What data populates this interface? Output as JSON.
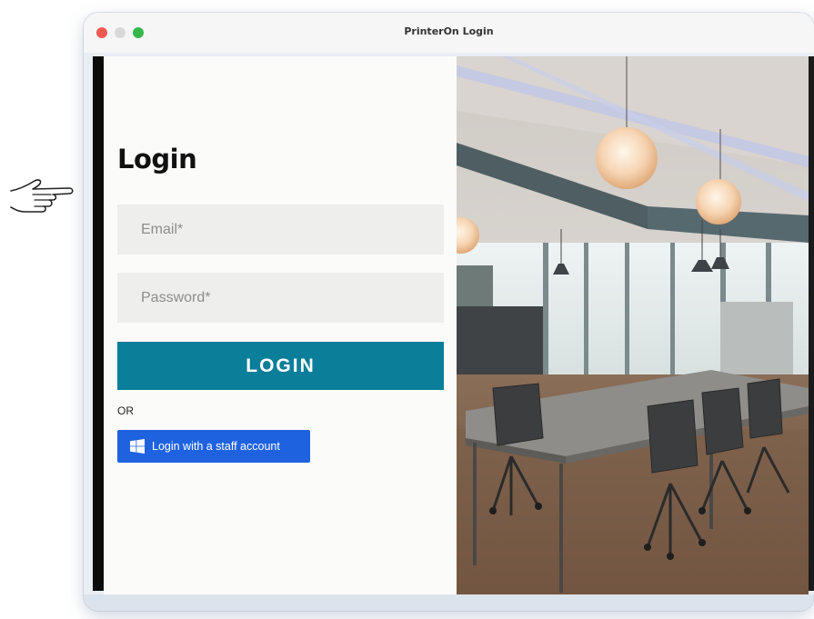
{
  "window": {
    "title": "PrinterOn Login"
  },
  "login": {
    "heading": "Login",
    "email_placeholder": "Email*",
    "password_placeholder": "Password*",
    "submit_label": "LOGIN",
    "or_text": "OR",
    "staff_button_label": "Login with a staff account"
  },
  "icons": {
    "pointer": "pointing-hand-icon",
    "staff_button": "windows-logo-icon",
    "window_controls": [
      "close-dot-icon",
      "minimize-dot-icon",
      "zoom-dot-icon"
    ]
  },
  "colors": {
    "accent": "#0b7e99",
    "staff_button": "#1f62e0",
    "field_background": "#eeeeed",
    "traffic_close": "#ee5a52",
    "traffic_zoom": "#34b84a"
  }
}
